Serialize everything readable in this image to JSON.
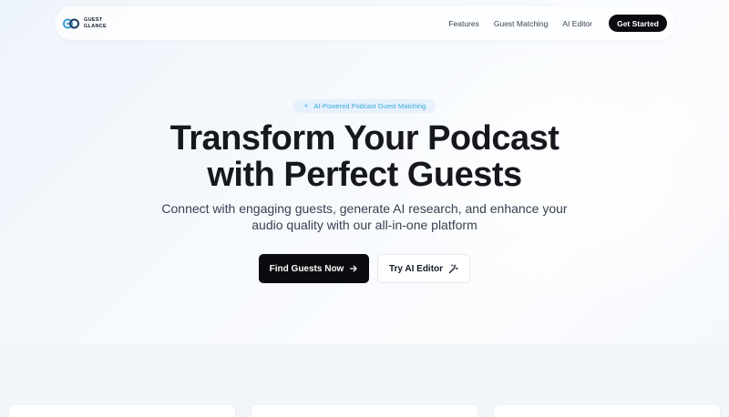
{
  "colors": {
    "accent": "#38a9d8",
    "dark_button": "#0b0b0f",
    "logo_blue": "#3aa0d6"
  },
  "header": {
    "logo_line1": "GUEST",
    "logo_line2": "GLANCE",
    "logo_icon": "interlocking-rings-icon",
    "nav": [
      {
        "label": "Features"
      },
      {
        "label": "Guest Matching"
      },
      {
        "label": "AI Editor"
      }
    ],
    "cta_label": "Get Started"
  },
  "hero": {
    "badge_icon": "sparkle-icon",
    "badge": "AI-Powered Podcast Guest Matching",
    "title_line1": "Transform Your Podcast",
    "title_line2": "with Perfect Guests",
    "subtitle_line1": "Connect with engaging guests, generate AI research, and enhance your",
    "subtitle_line2": "audio quality with our all-in-one platform",
    "primary_button": "Find Guests Now",
    "primary_icon": "arrow-right-icon",
    "secondary_button": "Try AI Editor",
    "secondary_icon": "magic-wand-icon"
  }
}
